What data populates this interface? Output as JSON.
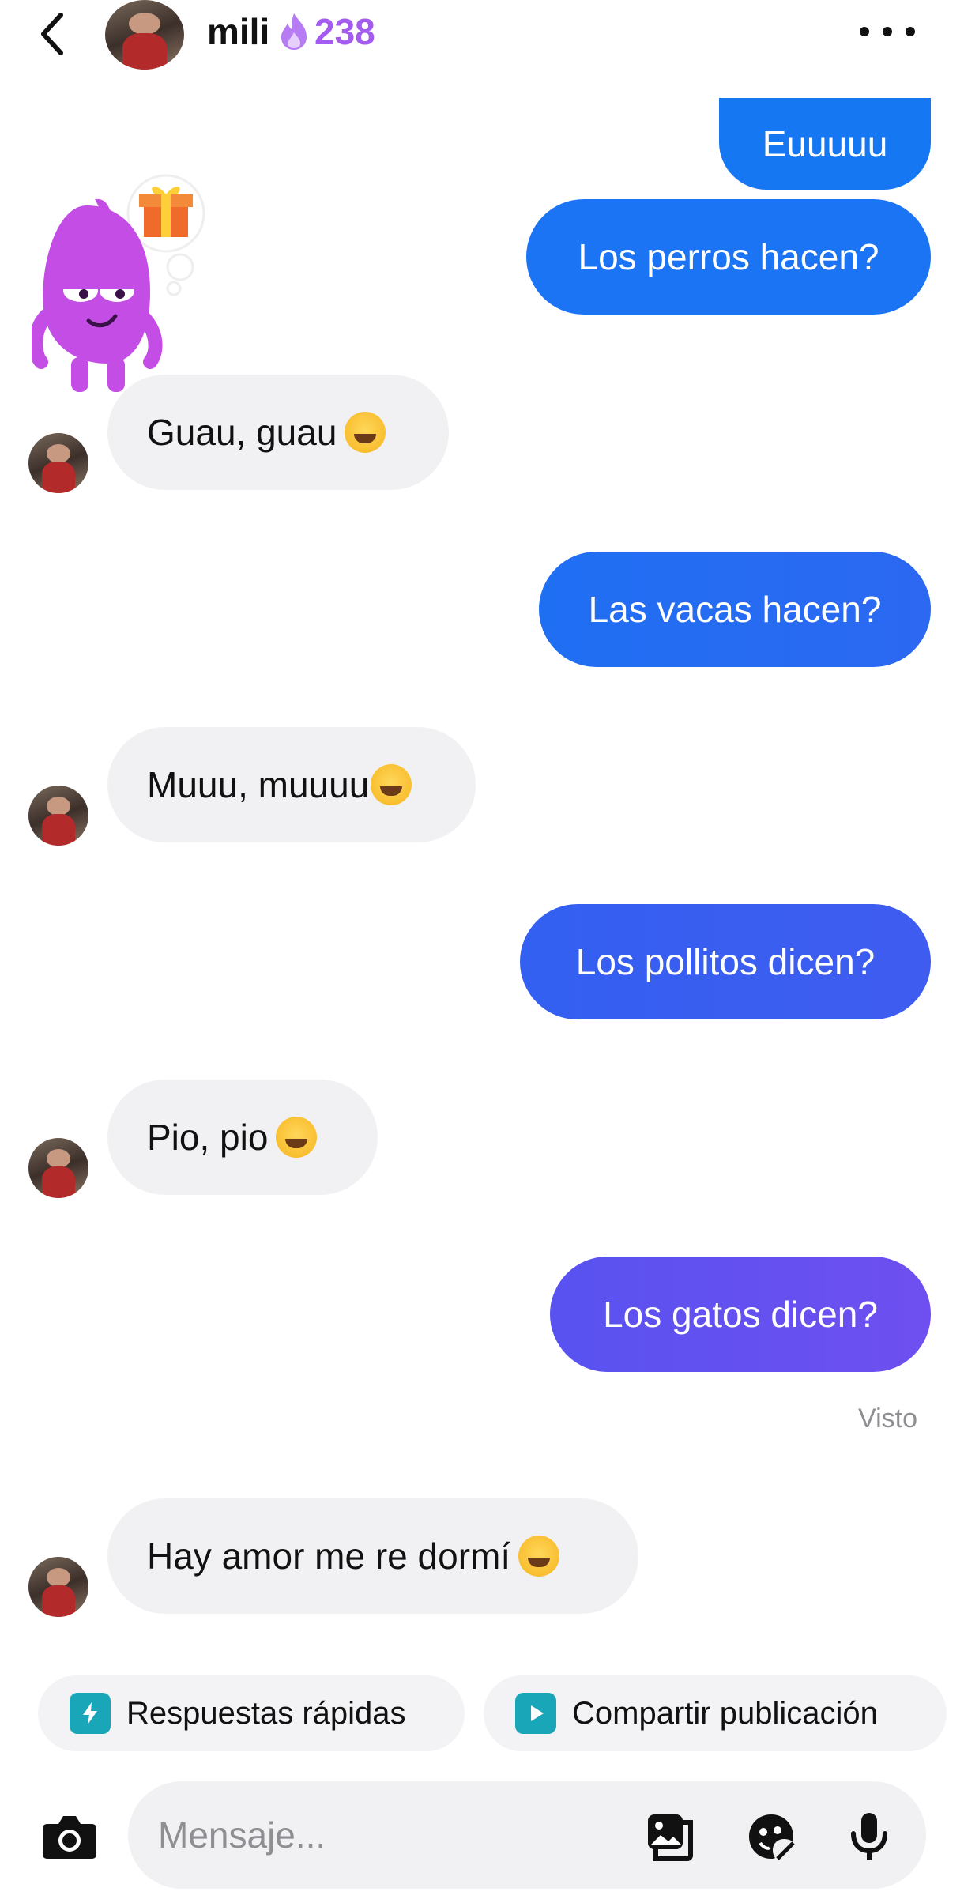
{
  "header": {
    "contact_name": "mili",
    "streak_count": "238",
    "back_icon": "chevron-left-icon",
    "more_icon": "more-horizontal-icon",
    "streak_icon": "flame-icon"
  },
  "messages": [
    {
      "side": "out",
      "text": "Euuuuu"
    },
    {
      "side": "out",
      "text": "Los perros hacen?"
    },
    {
      "side": "in",
      "text": "Guau, guau",
      "emoji": "😂"
    },
    {
      "side": "out",
      "text": "Las vacas hacen?"
    },
    {
      "side": "in",
      "text": "Muuu, muuuu",
      "emoji": "🙄"
    },
    {
      "side": "out",
      "text": "Los pollitos dicen?"
    },
    {
      "side": "in",
      "text": "Pio, pio",
      "emoji": "😆"
    },
    {
      "side": "out",
      "text": "Los gatos dicen?"
    },
    {
      "side": "in",
      "text": "Hay amor me re dormí",
      "emoji": "😂"
    }
  ],
  "status": {
    "seen_label": "Visto"
  },
  "quick_actions": {
    "quick_replies_label": "Respuestas rápidas",
    "share_post_label": "Compartir publicación"
  },
  "composer": {
    "placeholder": "Mensaje..."
  },
  "colors": {
    "bubble_out_start": "#1877f2",
    "bubble_out_end": "#6f4ff0",
    "bubble_in": "#f1f1f3",
    "streak": "#a45cf0",
    "quick_reply_icon": "#19a6b8",
    "share_icon": "#19a6b8"
  }
}
